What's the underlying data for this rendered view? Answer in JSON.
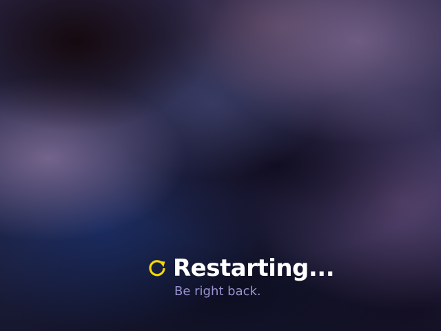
{
  "screen": {
    "title": "Restarting...",
    "subtitle": "Be right back.",
    "spinner_icon": "refresh-icon"
  },
  "colors": {
    "title": "#ffffff",
    "subtitle": "#9a93d0",
    "spinner": "#f5d800",
    "background": "#14152e"
  }
}
